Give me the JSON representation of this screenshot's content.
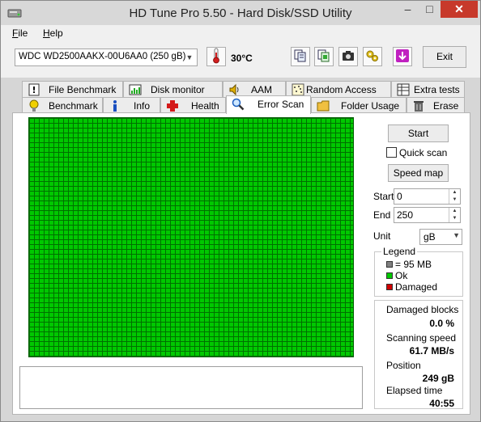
{
  "window": {
    "title": "HD Tune Pro 5.50 - Hard Disk/SSD Utility",
    "minimize": "–",
    "maximize": "□",
    "close": "✕"
  },
  "menu": {
    "file": "File",
    "file_accel": "F",
    "file_rest": "ile",
    "help": "Help",
    "help_accel": "H",
    "help_rest": "elp"
  },
  "toolbar": {
    "drive": "WDC WD2500AAKX-00U6AA0 (250 gB)",
    "temperature": "30°C",
    "icons": [
      "thermometer-icon",
      "copy-text-icon",
      "copy-info-icon",
      "screenshot-icon",
      "options-icon",
      "save-icon"
    ],
    "exit_label": "Exit"
  },
  "tabs": {
    "row1": [
      "File Benchmark",
      "Disk monitor",
      "AAM",
      "Random Access",
      "Extra tests"
    ],
    "row2": [
      "Benchmark",
      "Info",
      "Health",
      "Error Scan",
      "Folder Usage",
      "Erase"
    ],
    "active": "Error Scan"
  },
  "errorscan": {
    "start_label": "Start",
    "quick_scan_label": "Quick scan",
    "quick_scan_checked": false,
    "speed_map_label": "Speed map",
    "start_field_label": "Start",
    "start_value": "0",
    "end_field_label": "End",
    "end_value": "250",
    "unit_label": "Unit",
    "unit_value": "gB",
    "legend": {
      "title": "Legend",
      "block": "= 95 MB",
      "ok": "Ok",
      "damaged": "Damaged"
    },
    "stats": {
      "damaged_blocks_label": "Damaged blocks",
      "damaged_blocks_value": "0.0 %",
      "scanning_speed_label": "Scanning speed",
      "scanning_speed_value": "61.7 MB/s",
      "position_label": "Position",
      "position_value": "249 gB",
      "elapsed_label": "Elapsed time",
      "elapsed_value": "40:55"
    },
    "colors": {
      "ok": "#00c800",
      "damaged": "#d00000",
      "block": "#808080"
    }
  }
}
